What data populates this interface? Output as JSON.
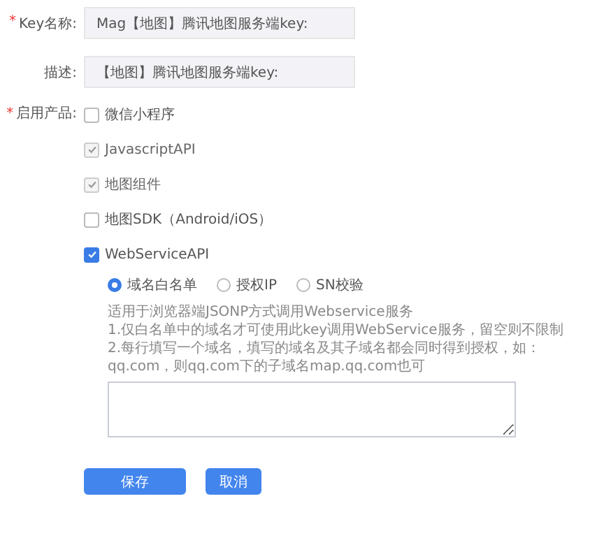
{
  "fields": [
    {
      "label": "Key名称:",
      "mark": "*",
      "value": "Mag【地图】腾讯地图服务端key:"
    },
    {
      "label": "描述:",
      "value": "【地图】腾讯地图服务端key:"
    }
  ],
  "products": {
    "label": "启用产品:",
    "mark": "*",
    "items": [
      {
        "label": "微信小程序",
        "checked": false,
        "disabled": false
      },
      {
        "label": "JavascriptAPI",
        "checked": true,
        "disabled": true
      },
      {
        "label": "地图组件",
        "checked": true,
        "disabled": true
      },
      {
        "label": "地图SDK（Android/iOS）",
        "checked": false,
        "disabled": false
      },
      {
        "label": "WebServiceAPI",
        "checked": true,
        "disabled": false
      }
    ]
  },
  "auth_modes": [
    {
      "label": "域名白名单",
      "selected": true
    },
    {
      "label": "授权IP",
      "selected": false
    },
    {
      "label": "SN校验",
      "selected": false
    }
  ],
  "help_lines": [
    "适用于浏览器端JSONP方式调用Webservice服务",
    "1.仅白名单中的域名才可使用此key调用WebService服务，留空则不限制",
    "2.每行填写一个域名，填写的域名及其子域名都会同时得到授权，如：qq.com，则qq.com下的子域名map.qq.com也可"
  ],
  "buttons": [
    "保存",
    "取消"
  ]
}
